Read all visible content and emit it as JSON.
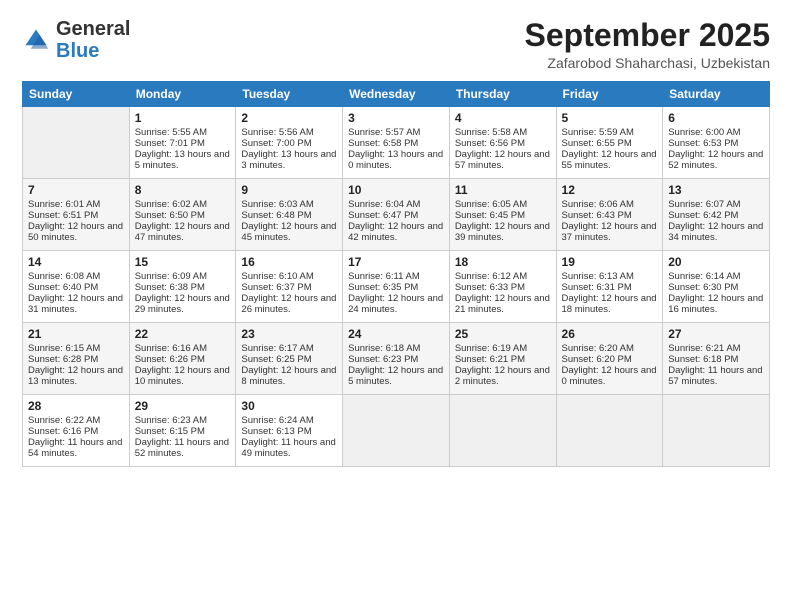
{
  "header": {
    "logo_general": "General",
    "logo_blue": "Blue",
    "month_title": "September 2025",
    "subtitle": "Zafarobod Shaharchasi, Uzbekistan"
  },
  "days_of_week": [
    "Sunday",
    "Monday",
    "Tuesday",
    "Wednesday",
    "Thursday",
    "Friday",
    "Saturday"
  ],
  "weeks": [
    [
      {
        "day": "",
        "empty": true
      },
      {
        "day": "1",
        "sunrise": "Sunrise: 5:55 AM",
        "sunset": "Sunset: 7:01 PM",
        "daylight": "Daylight: 13 hours and 5 minutes."
      },
      {
        "day": "2",
        "sunrise": "Sunrise: 5:56 AM",
        "sunset": "Sunset: 7:00 PM",
        "daylight": "Daylight: 13 hours and 3 minutes."
      },
      {
        "day": "3",
        "sunrise": "Sunrise: 5:57 AM",
        "sunset": "Sunset: 6:58 PM",
        "daylight": "Daylight: 13 hours and 0 minutes."
      },
      {
        "day": "4",
        "sunrise": "Sunrise: 5:58 AM",
        "sunset": "Sunset: 6:56 PM",
        "daylight": "Daylight: 12 hours and 57 minutes."
      },
      {
        "day": "5",
        "sunrise": "Sunrise: 5:59 AM",
        "sunset": "Sunset: 6:55 PM",
        "daylight": "Daylight: 12 hours and 55 minutes."
      },
      {
        "day": "6",
        "sunrise": "Sunrise: 6:00 AM",
        "sunset": "Sunset: 6:53 PM",
        "daylight": "Daylight: 12 hours and 52 minutes."
      }
    ],
    [
      {
        "day": "7",
        "sunrise": "Sunrise: 6:01 AM",
        "sunset": "Sunset: 6:51 PM",
        "daylight": "Daylight: 12 hours and 50 minutes."
      },
      {
        "day": "8",
        "sunrise": "Sunrise: 6:02 AM",
        "sunset": "Sunset: 6:50 PM",
        "daylight": "Daylight: 12 hours and 47 minutes."
      },
      {
        "day": "9",
        "sunrise": "Sunrise: 6:03 AM",
        "sunset": "Sunset: 6:48 PM",
        "daylight": "Daylight: 12 hours and 45 minutes."
      },
      {
        "day": "10",
        "sunrise": "Sunrise: 6:04 AM",
        "sunset": "Sunset: 6:47 PM",
        "daylight": "Daylight: 12 hours and 42 minutes."
      },
      {
        "day": "11",
        "sunrise": "Sunrise: 6:05 AM",
        "sunset": "Sunset: 6:45 PM",
        "daylight": "Daylight: 12 hours and 39 minutes."
      },
      {
        "day": "12",
        "sunrise": "Sunrise: 6:06 AM",
        "sunset": "Sunset: 6:43 PM",
        "daylight": "Daylight: 12 hours and 37 minutes."
      },
      {
        "day": "13",
        "sunrise": "Sunrise: 6:07 AM",
        "sunset": "Sunset: 6:42 PM",
        "daylight": "Daylight: 12 hours and 34 minutes."
      }
    ],
    [
      {
        "day": "14",
        "sunrise": "Sunrise: 6:08 AM",
        "sunset": "Sunset: 6:40 PM",
        "daylight": "Daylight: 12 hours and 31 minutes."
      },
      {
        "day": "15",
        "sunrise": "Sunrise: 6:09 AM",
        "sunset": "Sunset: 6:38 PM",
        "daylight": "Daylight: 12 hours and 29 minutes."
      },
      {
        "day": "16",
        "sunrise": "Sunrise: 6:10 AM",
        "sunset": "Sunset: 6:37 PM",
        "daylight": "Daylight: 12 hours and 26 minutes."
      },
      {
        "day": "17",
        "sunrise": "Sunrise: 6:11 AM",
        "sunset": "Sunset: 6:35 PM",
        "daylight": "Daylight: 12 hours and 24 minutes."
      },
      {
        "day": "18",
        "sunrise": "Sunrise: 6:12 AM",
        "sunset": "Sunset: 6:33 PM",
        "daylight": "Daylight: 12 hours and 21 minutes."
      },
      {
        "day": "19",
        "sunrise": "Sunrise: 6:13 AM",
        "sunset": "Sunset: 6:31 PM",
        "daylight": "Daylight: 12 hours and 18 minutes."
      },
      {
        "day": "20",
        "sunrise": "Sunrise: 6:14 AM",
        "sunset": "Sunset: 6:30 PM",
        "daylight": "Daylight: 12 hours and 16 minutes."
      }
    ],
    [
      {
        "day": "21",
        "sunrise": "Sunrise: 6:15 AM",
        "sunset": "Sunset: 6:28 PM",
        "daylight": "Daylight: 12 hours and 13 minutes."
      },
      {
        "day": "22",
        "sunrise": "Sunrise: 6:16 AM",
        "sunset": "Sunset: 6:26 PM",
        "daylight": "Daylight: 12 hours and 10 minutes."
      },
      {
        "day": "23",
        "sunrise": "Sunrise: 6:17 AM",
        "sunset": "Sunset: 6:25 PM",
        "daylight": "Daylight: 12 hours and 8 minutes."
      },
      {
        "day": "24",
        "sunrise": "Sunrise: 6:18 AM",
        "sunset": "Sunset: 6:23 PM",
        "daylight": "Daylight: 12 hours and 5 minutes."
      },
      {
        "day": "25",
        "sunrise": "Sunrise: 6:19 AM",
        "sunset": "Sunset: 6:21 PM",
        "daylight": "Daylight: 12 hours and 2 minutes."
      },
      {
        "day": "26",
        "sunrise": "Sunrise: 6:20 AM",
        "sunset": "Sunset: 6:20 PM",
        "daylight": "Daylight: 12 hours and 0 minutes."
      },
      {
        "day": "27",
        "sunrise": "Sunrise: 6:21 AM",
        "sunset": "Sunset: 6:18 PM",
        "daylight": "Daylight: 11 hours and 57 minutes."
      }
    ],
    [
      {
        "day": "28",
        "sunrise": "Sunrise: 6:22 AM",
        "sunset": "Sunset: 6:16 PM",
        "daylight": "Daylight: 11 hours and 54 minutes."
      },
      {
        "day": "29",
        "sunrise": "Sunrise: 6:23 AM",
        "sunset": "Sunset: 6:15 PM",
        "daylight": "Daylight: 11 hours and 52 minutes."
      },
      {
        "day": "30",
        "sunrise": "Sunrise: 6:24 AM",
        "sunset": "Sunset: 6:13 PM",
        "daylight": "Daylight: 11 hours and 49 minutes."
      },
      {
        "day": "",
        "empty": true
      },
      {
        "day": "",
        "empty": true
      },
      {
        "day": "",
        "empty": true
      },
      {
        "day": "",
        "empty": true
      }
    ]
  ]
}
